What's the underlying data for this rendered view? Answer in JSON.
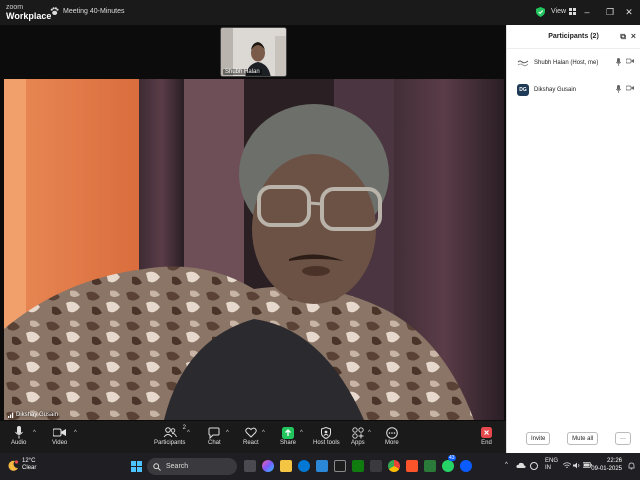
{
  "titlebar": {
    "brand_line1": "zoom",
    "brand_line2": "Workplace",
    "meeting_title": "Meeting 40-Minutes",
    "view_label": "View"
  },
  "thumbnail": {
    "name": "Shubh Halan"
  },
  "main_video": {
    "name": "Dikshay Gusain"
  },
  "panel": {
    "title": "Participants (2)",
    "participants": [
      {
        "name": "Shubh Halan (Host, me)",
        "avatar_color": "#2d2d2d"
      },
      {
        "name": "Dikshay Gusain",
        "initials": "DG",
        "avatar_color": "#1f3b57"
      }
    ],
    "invite_label": "Invite",
    "mute_all_label": "Mute all",
    "more_label": "···"
  },
  "toolbar": {
    "audio": "Audio",
    "video": "Video",
    "participants": "Participants",
    "participants_count": "2",
    "chat": "Chat",
    "react": "React",
    "share": "Share",
    "host_tools": "Host tools",
    "apps": "Apps",
    "more": "More",
    "end": "End"
  },
  "taskbar": {
    "temperature": "12°C",
    "condition": "Clear",
    "search_placeholder": "Search",
    "lang1": "ENG",
    "lang2": "IN",
    "time": "22:26",
    "date": "09-01-2025",
    "badge_count": "43"
  },
  "colors": {
    "accent_green": "#22c55e",
    "end_red": "#e5484d",
    "zoom_blue": "#0b5cff"
  }
}
